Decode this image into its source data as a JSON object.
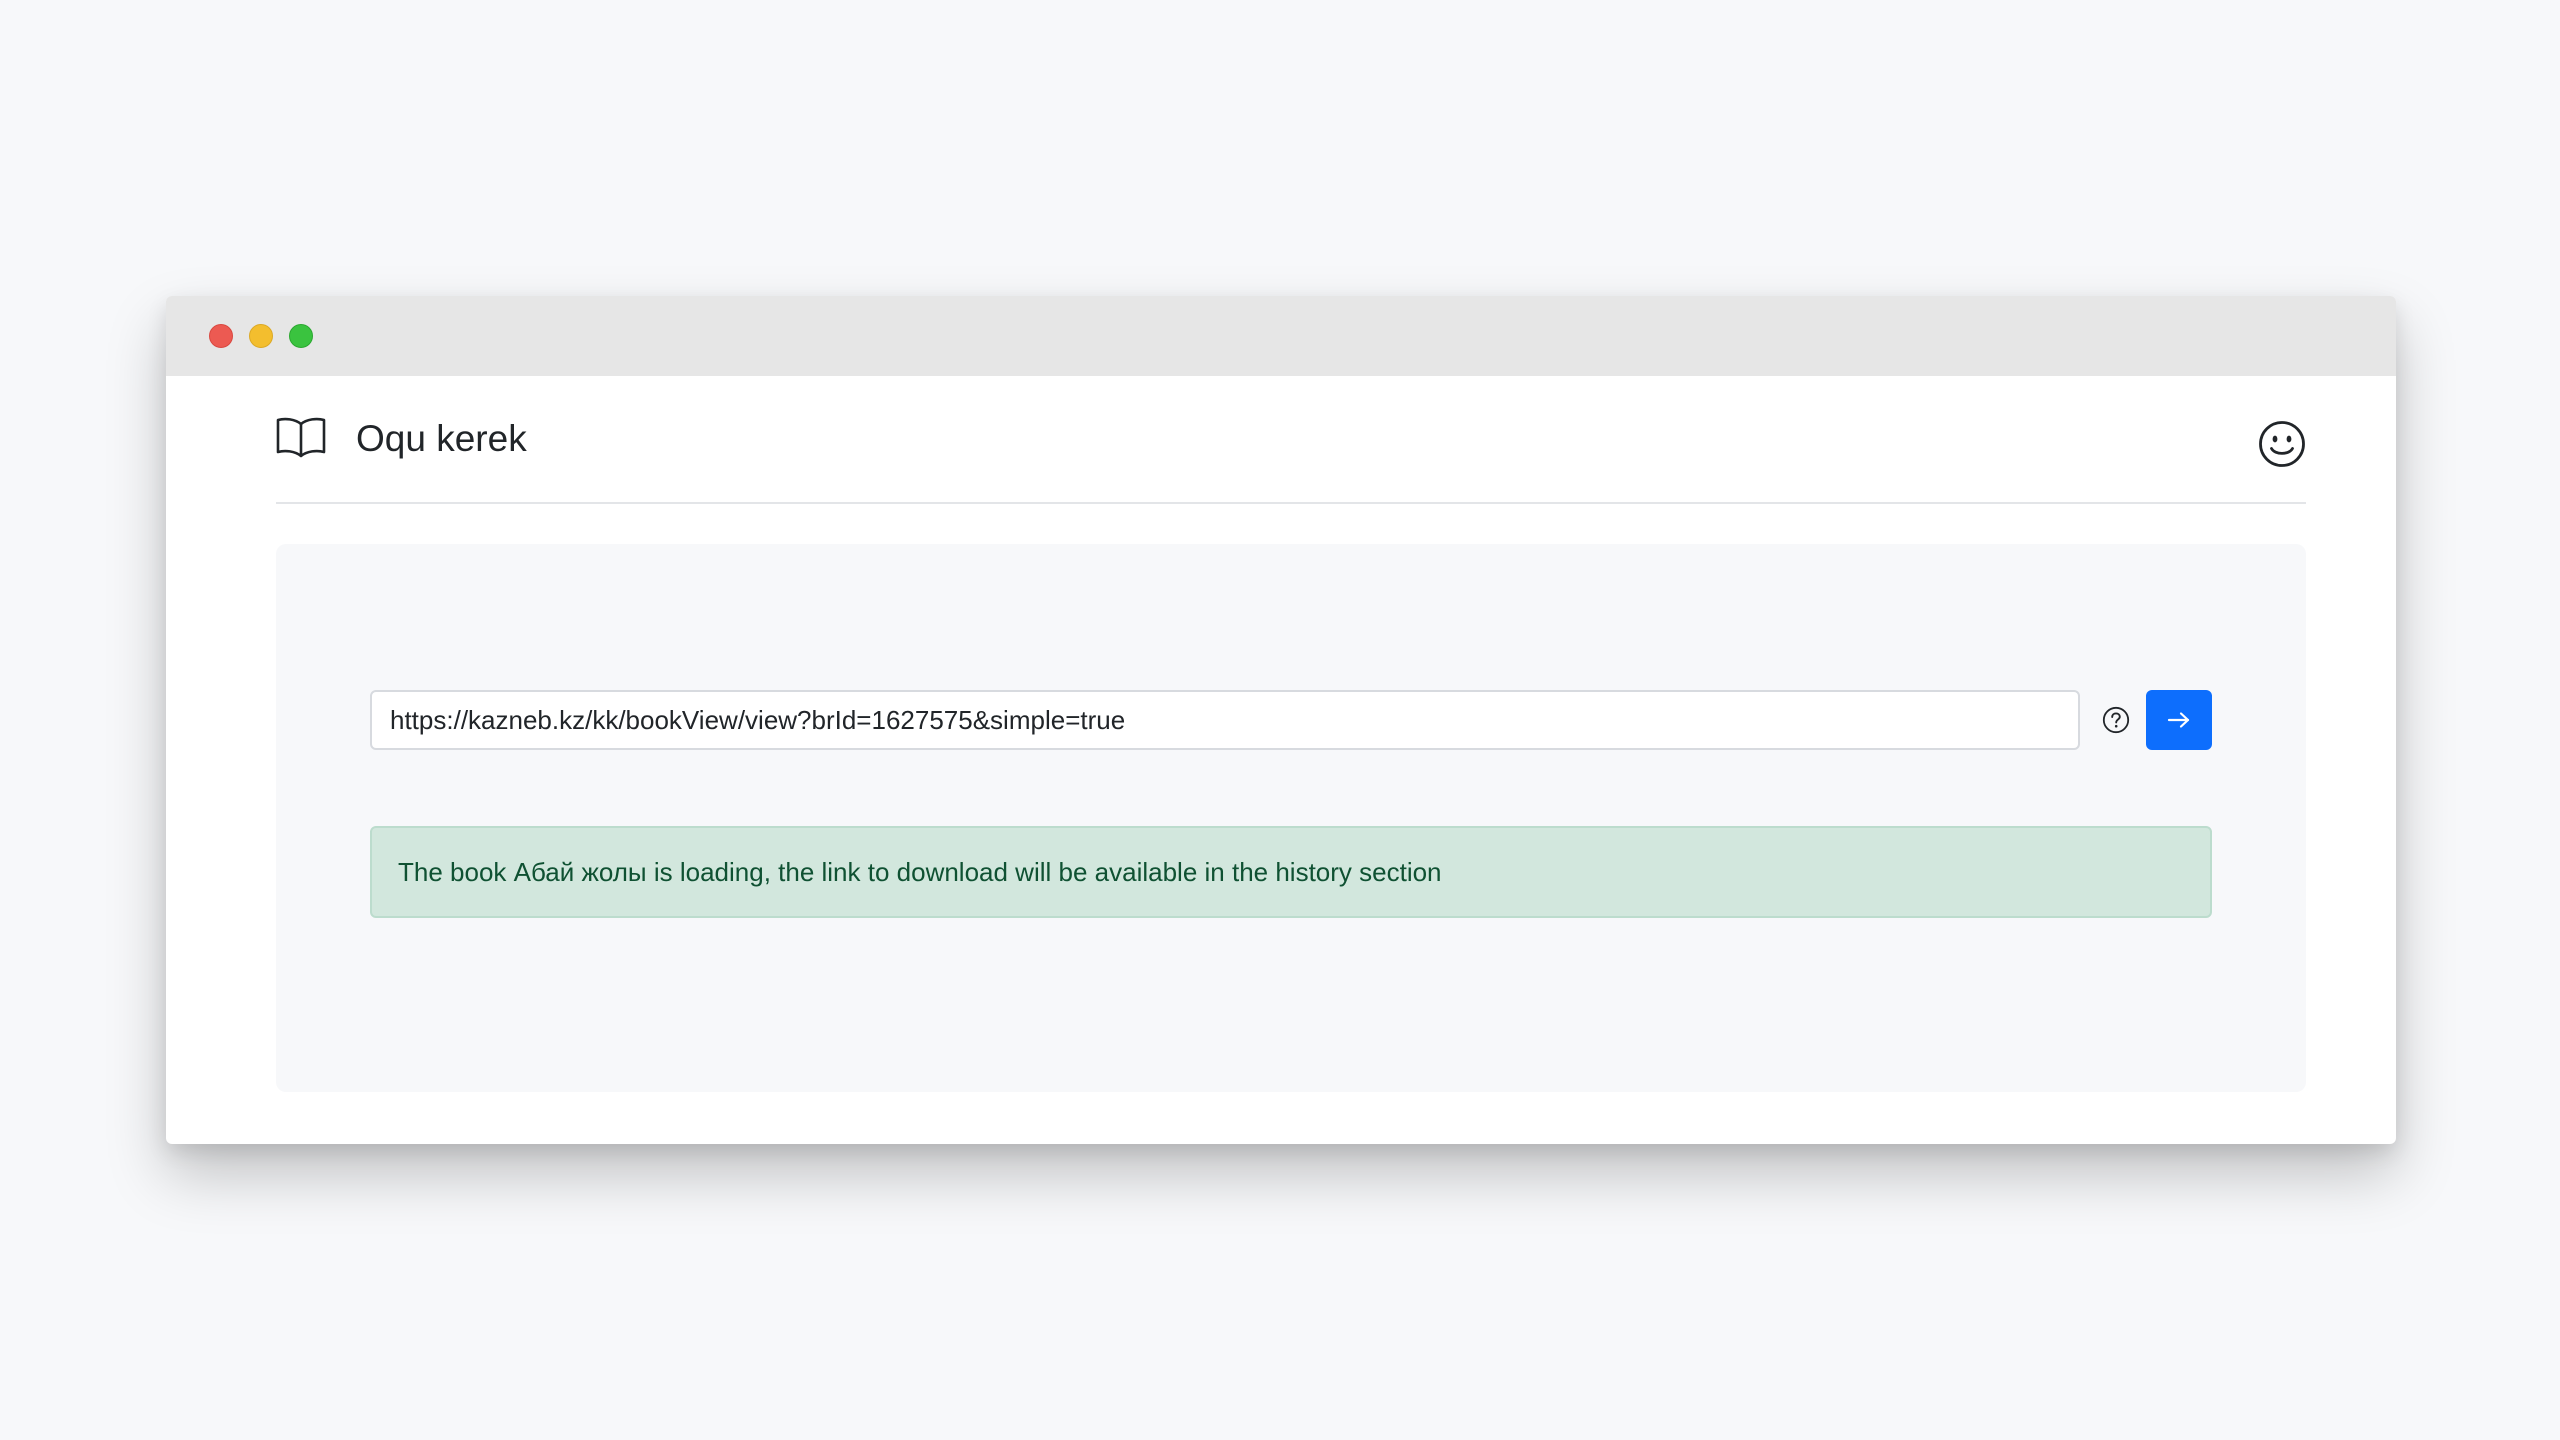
{
  "window": {
    "controls": [
      "close",
      "minimize",
      "zoom"
    ]
  },
  "header": {
    "logo_icon": "open-book-icon",
    "brand": "Oqu kerek",
    "profile_icon": "smiley-face-icon"
  },
  "form": {
    "url_value": "https://kazneb.kz/kk/bookView/view?brId=1627575&simple=true",
    "help_icon": "question-circle-icon",
    "submit_icon": "arrow-right-icon",
    "submit_color": "#0d6efd"
  },
  "alert": {
    "message": "The book Абай жолы is loading, the link to download will be available in the history section",
    "background": "#d2e7dd",
    "text_color": "#0f5132"
  }
}
